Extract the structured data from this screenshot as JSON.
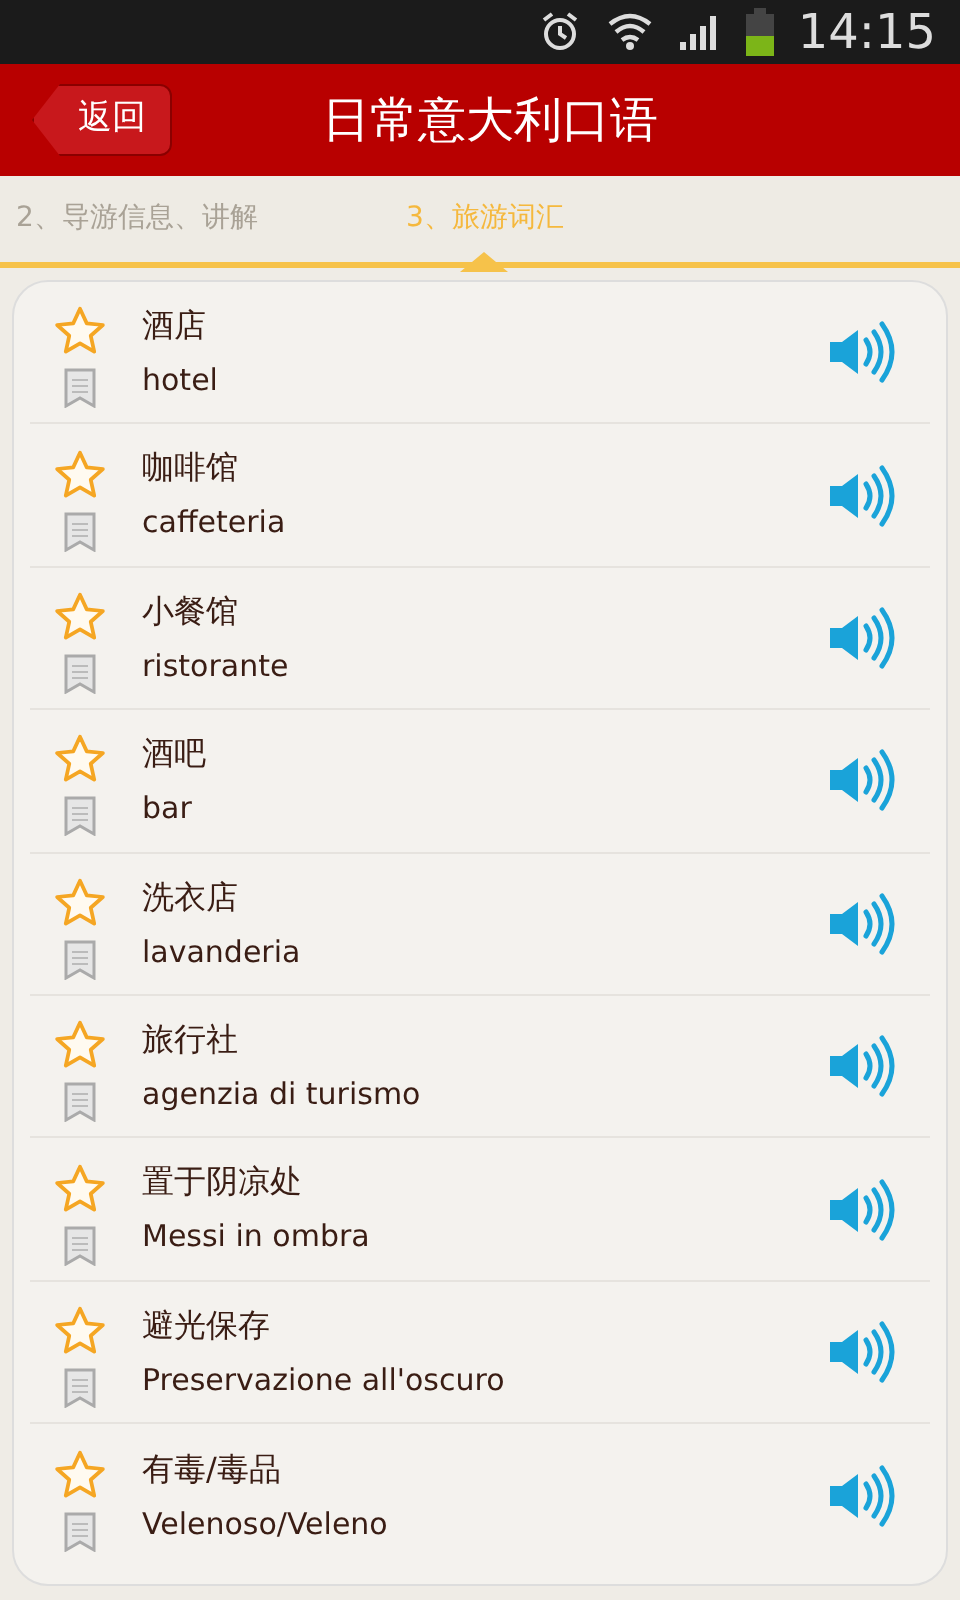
{
  "status_bar": {
    "time": "14:15"
  },
  "header": {
    "back_button": "返回",
    "title": "日常意大利口语"
  },
  "tabs": [
    {
      "label": "2、导游信息、讲解",
      "selected": false
    },
    {
      "label": "3、旅游词汇",
      "selected": true
    }
  ],
  "words": [
    {
      "chinese": "酒店",
      "italian": "hotel"
    },
    {
      "chinese": "咖啡馆",
      "italian": "caffeteria"
    },
    {
      "chinese": "小餐馆",
      "italian": "ristorante"
    },
    {
      "chinese": "酒吧",
      "italian": "bar"
    },
    {
      "chinese": "洗衣店",
      "italian": "lavanderia"
    },
    {
      "chinese": "旅行社",
      "italian": "agenzia di turismo"
    },
    {
      "chinese": "置于阴凉处",
      "italian": "Messi in ombra"
    },
    {
      "chinese": "避光保存",
      "italian": "Preservazione all'oscuro"
    },
    {
      "chinese": "有毒/毒品",
      "italian": "Velenoso/Veleno"
    }
  ]
}
